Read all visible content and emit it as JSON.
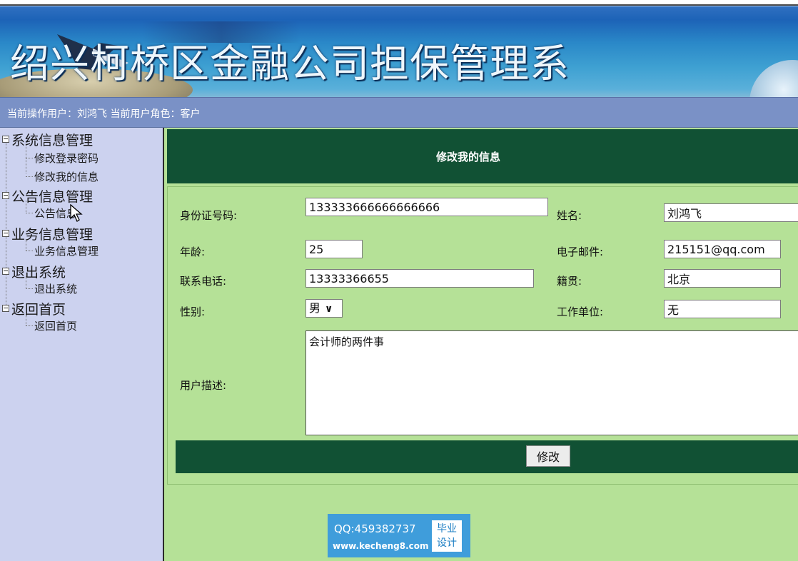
{
  "banner": {
    "title": "绍兴柯桥区金融公司担保管理系"
  },
  "userbar": {
    "text": "当前操作用户：刘鸿飞 当前用户角色：客户"
  },
  "sidebar": {
    "groups": [
      {
        "label": "系统信息管理",
        "items": [
          "修改登录密码",
          "修改我的信息"
        ]
      },
      {
        "label": "公告信息管理",
        "items": [
          "公告信息"
        ]
      },
      {
        "label": "业务信息管理",
        "items": [
          "业务信息管理"
        ]
      },
      {
        "label": "退出系统",
        "items": [
          "退出系统"
        ]
      },
      {
        "label": "返回首页",
        "items": [
          "返回首页"
        ]
      }
    ]
  },
  "form": {
    "header": "修改我的信息",
    "id_label": "身份证号码:",
    "id_value": "133333666666666666",
    "name_label": "姓名:",
    "name_value": "刘鸿飞",
    "age_label": "年龄:",
    "age_value": "25",
    "email_label": "电子邮件:",
    "email_value": "215151@qq.com",
    "phone_label": "联系电话:",
    "phone_value": "13333366655",
    "origin_label": "籍贯:",
    "origin_value": "北京",
    "gender_label": "性别:",
    "gender_value": "男",
    "work_label": "工作单位:",
    "work_value": "无",
    "desc_label": "用户描述:",
    "desc_value": "会计师的两件事",
    "submit_label": "修改"
  },
  "watermark": {
    "qq": "QQ:459382737",
    "site": "www.kecheng8.com",
    "badge_line1": "毕业",
    "badge_line2": "设计"
  }
}
